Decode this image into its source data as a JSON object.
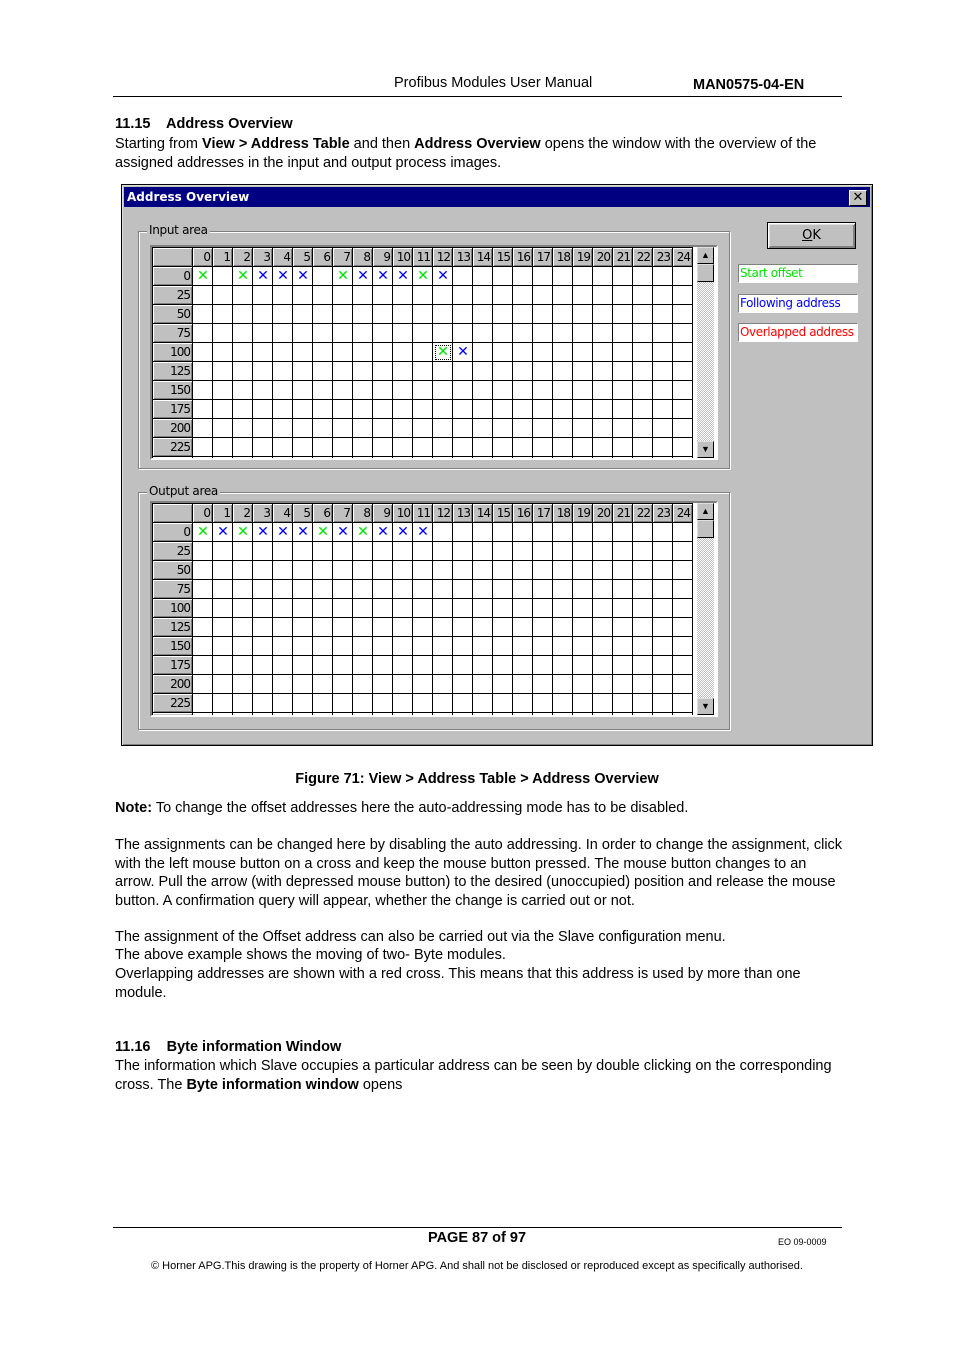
{
  "header": {
    "title": "Profibus Modules User Manual",
    "doc_code": "MAN0575-04-EN"
  },
  "section_1115": {
    "heading": "11.15    Address Overview",
    "intro_parts": [
      "Starting from ",
      "View > Address Table",
      " and then ",
      "Address Overview",
      " opens the window with the overview of the assigned addresses in the input and output process images."
    ]
  },
  "dialog": {
    "title": "Address Overview",
    "close_icon": "close-x-icon",
    "ok_label": "OK",
    "ok_mnemonic": "O",
    "ok_rest": "K",
    "legend": [
      {
        "label": "Start offset",
        "color": "#00e000"
      },
      {
        "label": "Following address",
        "color": "#0000ff"
      },
      {
        "label": "Overlapped address",
        "color": "#ff0000"
      }
    ],
    "input_area": {
      "label": "Input area",
      "columns": [
        "0",
        "1",
        "2",
        "3",
        "4",
        "5",
        "6",
        "7",
        "8",
        "9",
        "10",
        "11",
        "12",
        "13",
        "14",
        "15",
        "16",
        "17",
        "18",
        "19",
        "20",
        "21",
        "22",
        "23",
        "24"
      ],
      "rows": [
        "0",
        "25",
        "50",
        "75",
        "100",
        "125",
        "150",
        "175",
        "200",
        "225"
      ],
      "marks": [
        {
          "row": "0",
          "col": 0,
          "type": "start"
        },
        {
          "row": "0",
          "col": 2,
          "type": "start"
        },
        {
          "row": "0",
          "col": 3,
          "type": "follow"
        },
        {
          "row": "0",
          "col": 4,
          "type": "follow"
        },
        {
          "row": "0",
          "col": 5,
          "type": "follow"
        },
        {
          "row": "0",
          "col": 7,
          "type": "start"
        },
        {
          "row": "0",
          "col": 8,
          "type": "follow"
        },
        {
          "row": "0",
          "col": 9,
          "type": "follow"
        },
        {
          "row": "0",
          "col": 10,
          "type": "follow"
        },
        {
          "row": "0",
          "col": 11,
          "type": "start"
        },
        {
          "row": "0",
          "col": 12,
          "type": "follow"
        },
        {
          "row": "100",
          "col": 12,
          "type": "start",
          "selected": true
        },
        {
          "row": "100",
          "col": 13,
          "type": "follow"
        }
      ]
    },
    "output_area": {
      "label": "Output area",
      "columns": [
        "0",
        "1",
        "2",
        "3",
        "4",
        "5",
        "6",
        "7",
        "8",
        "9",
        "10",
        "11",
        "12",
        "13",
        "14",
        "15",
        "16",
        "17",
        "18",
        "19",
        "20",
        "21",
        "22",
        "23",
        "24"
      ],
      "rows": [
        "0",
        "25",
        "50",
        "75",
        "100",
        "125",
        "150",
        "175",
        "200",
        "225"
      ],
      "marks": [
        {
          "row": "0",
          "col": 0,
          "type": "start"
        },
        {
          "row": "0",
          "col": 1,
          "type": "follow"
        },
        {
          "row": "0",
          "col": 2,
          "type": "start"
        },
        {
          "row": "0",
          "col": 3,
          "type": "follow"
        },
        {
          "row": "0",
          "col": 4,
          "type": "follow"
        },
        {
          "row": "0",
          "col": 5,
          "type": "follow"
        },
        {
          "row": "0",
          "col": 6,
          "type": "start"
        },
        {
          "row": "0",
          "col": 7,
          "type": "follow"
        },
        {
          "row": "0",
          "col": 8,
          "type": "start"
        },
        {
          "row": "0",
          "col": 9,
          "type": "follow"
        },
        {
          "row": "0",
          "col": 10,
          "type": "follow"
        },
        {
          "row": "0",
          "col": 11,
          "type": "follow"
        }
      ]
    },
    "mark_glyph": "✕",
    "scroll_up_glyph": "▲",
    "scroll_down_glyph": "▼"
  },
  "figure_caption": "Figure 71: View > Address Table > Address Overview",
  "note": {
    "label": "Note:",
    "text": " To change the offset addresses here the auto-addressing mode has to be disabled."
  },
  "paragraphs": [
    "The assignments can be changed here by disabling the auto addressing.  In order to change the assignment, click with the left mouse button on a cross and keep the mouse button pressed.  The mouse button changes to an arrow.  Pull the arrow (with depressed mouse button) to the desired (unoccupied) position and release the mouse button.  A confirmation query will appear, whether the change is carried out or not.",
    "The assignment of the Offset address can also be carried out via the Slave configuration menu.",
    "The above example shows the moving of two- Byte modules.",
    "Overlapping addresses are shown with a red cross.  This means that this address is used by more than one module."
  ],
  "section_1116": {
    "heading": "11.16    Byte information Window",
    "text_parts": [
      "The information which Slave occupies a particular address can be seen by double clicking on the corresponding cross.  The ",
      "Byte information window",
      " opens"
    ]
  },
  "footer": {
    "page": "PAGE 87 of 97",
    "eo": "EO 09-0009",
    "copyright": "© Horner APG.This drawing is the property of Horner APG. And shall not be disclosed or reproduced except as specifically authorised."
  }
}
